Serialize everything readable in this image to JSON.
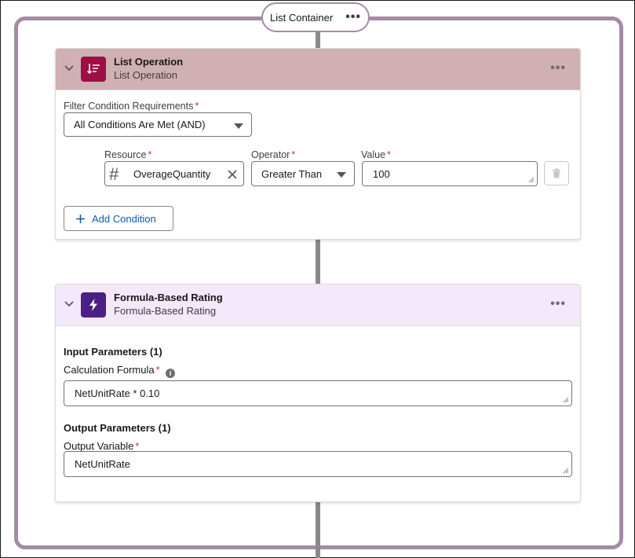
{
  "container": {
    "label": "List Container",
    "menu": "•••"
  },
  "list_operation": {
    "title": "List Operation",
    "subtitle": "List Operation",
    "menu": "•••",
    "header_color": "#d0b0b2",
    "icon_color": "#9e0f45",
    "filter_label": "Filter Condition Requirements",
    "filter_value": "All Conditions Are Met (AND)",
    "resource_label": "Resource",
    "resource_value": "OverageQuantity",
    "resource_type_symbol": "#",
    "operator_label": "Operator",
    "operator_value": "Greater Than",
    "value_label": "Value",
    "value_value": "100",
    "add_condition_label": "Add Condition",
    "required_mark": "*"
  },
  "formula_rating": {
    "title": "Formula-Based Rating",
    "subtitle": "Formula-Based Rating",
    "menu": "•••",
    "header_color": "#f4e8fb",
    "icon_color": "#4b1f86",
    "input_section": "Input Parameters (1)",
    "formula_label": "Calculation Formula",
    "formula_value": "NetUnitRate * 0.10",
    "output_section": "Output Parameters (1)",
    "output_label": "Output Variable",
    "output_value": "NetUnitRate",
    "required_mark": "*",
    "info_symbol": "i"
  },
  "colors": {
    "container_border": "#a48ba6",
    "connector": "#8a8a8a",
    "link_blue": "#0b5cab"
  }
}
